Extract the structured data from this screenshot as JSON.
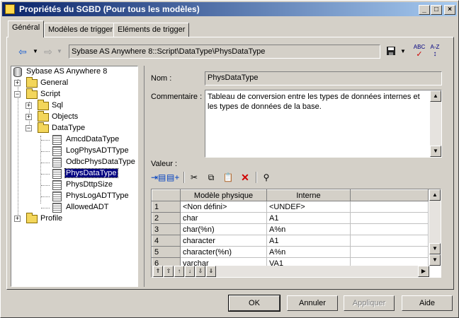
{
  "window": {
    "title": "Propriétés du SGBD (Pour tous les modèles)",
    "controls": [
      "_",
      "□",
      "×"
    ]
  },
  "tabs": [
    {
      "label": "Général",
      "active": true
    },
    {
      "label": "Modèles de trigger",
      "active": false
    },
    {
      "label": "Eléments de trigger",
      "active": false
    }
  ],
  "toolbar": {
    "path": "Sybase AS Anywhere 8::Script\\DataType\\PhysDataType",
    "spell_label": "ABC",
    "az_label": "A-Z"
  },
  "tree": {
    "root": "Sybase AS Anywhere 8",
    "items": [
      {
        "label": "General"
      },
      {
        "label": "Script"
      },
      {
        "label": "Sql"
      },
      {
        "label": "Objects"
      },
      {
        "label": "DataType"
      },
      {
        "label": "AmcdDataType"
      },
      {
        "label": "LogPhysADTType"
      },
      {
        "label": "OdbcPhysDataType"
      },
      {
        "label": "PhysDataType",
        "selected": true
      },
      {
        "label": "PhysDttpSize"
      },
      {
        "label": "PhysLogADTType"
      },
      {
        "label": "AllowedADT"
      },
      {
        "label": "Profile"
      }
    ]
  },
  "form": {
    "name_label": "Nom :",
    "name_value": "PhysDataType",
    "comment_label": "Commentaire :",
    "comment_value": "Tableau de conversion entre les types de données internes et les types de données de la base.",
    "value_label": "Valeur :"
  },
  "grid": {
    "columns": [
      "Modèle physique",
      "Interne"
    ],
    "rows": [
      {
        "num": "1",
        "model": "<Non défini>",
        "internal": "<UNDEF>"
      },
      {
        "num": "2",
        "model": "char",
        "internal": "A1"
      },
      {
        "num": "3",
        "model": "char(%n)",
        "internal": "A%n"
      },
      {
        "num": "4",
        "model": "character",
        "internal": "A1"
      },
      {
        "num": "5",
        "model": "character(%n)",
        "internal": "A%n"
      },
      {
        "num": "6",
        "model": "varchar",
        "internal": "VA1"
      }
    ]
  },
  "buttons": {
    "ok": "OK",
    "cancel": "Annuler",
    "apply": "Appliquer",
    "help": "Aide"
  },
  "colors": {
    "title_start": "#0a246a",
    "title_end": "#a6caf0",
    "selection": "#000080",
    "face": "#d4d0c8",
    "delete_red": "#d00000"
  }
}
